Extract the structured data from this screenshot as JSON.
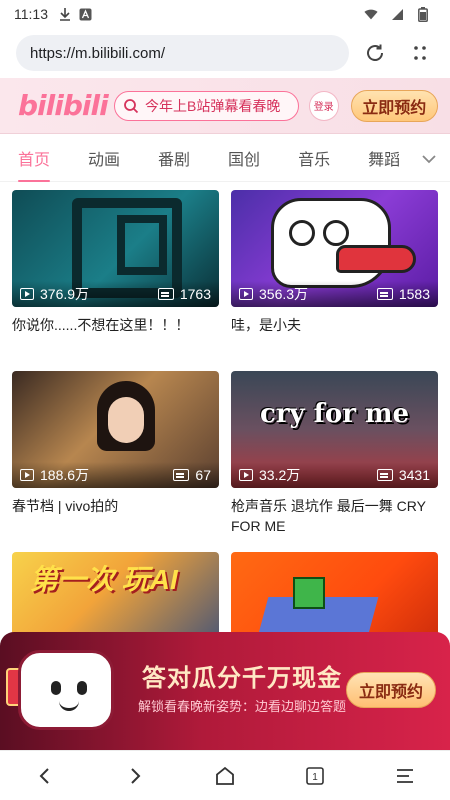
{
  "status_bar": {
    "time": "11:13"
  },
  "browser": {
    "url": "https://m.bilibili.com/",
    "tab_count": "1"
  },
  "header": {
    "logo": "bilibili",
    "search_text": "今年上B站弹幕看春晚",
    "login_label": "登录",
    "reserve_label": "立即预约"
  },
  "tabs": [
    {
      "label": "首页"
    },
    {
      "label": "动画"
    },
    {
      "label": "番剧"
    },
    {
      "label": "国创"
    },
    {
      "label": "音乐"
    },
    {
      "label": "舞蹈"
    }
  ],
  "videos": [
    {
      "views": "376.9万",
      "danmaku": "1763",
      "title": "你说你......不想在这里！！！"
    },
    {
      "views": "356.3万",
      "danmaku": "1583",
      "title": "哇，是小夫"
    },
    {
      "views": "188.6万",
      "danmaku": "67",
      "title": "春节档 | vivo拍的"
    },
    {
      "views": "33.2万",
      "danmaku": "3431",
      "title": "枪声音乐 退坑作 最后一舞 CRY FOR ME",
      "thumb_text": "cry for me"
    },
    {
      "views": "",
      "danmaku": "",
      "title": "",
      "thumb_text": "第一次 玩AI"
    },
    {
      "views": "",
      "danmaku": "",
      "title": ""
    }
  ],
  "promo": {
    "title": "答对瓜分千万现金",
    "subtitle": "解锁看春晚新姿势：边看边聊边答题",
    "button_label": "立即预约"
  },
  "colors": {
    "brand": "#fb7299",
    "promo_bg": "#b01a3a",
    "button_gold": "#ffc77a"
  }
}
